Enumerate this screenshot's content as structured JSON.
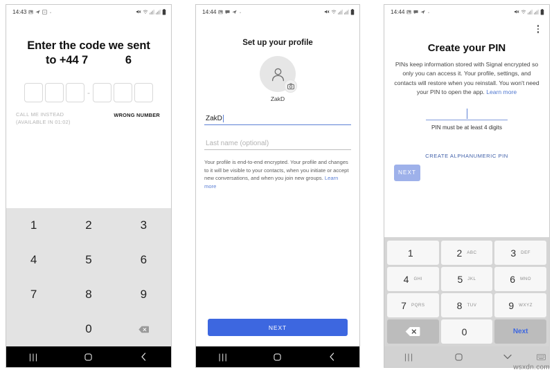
{
  "watermark": "wsxdn.com",
  "panel1": {
    "statusbar": {
      "time": "14:43",
      "left_icons": [
        "image-icon",
        "send-icon",
        "screenshot-icon",
        "dot-icon"
      ],
      "right_icons": [
        "mute-icon",
        "wifi-icon",
        "signal-icon",
        "signal2-icon",
        "battery-icon"
      ]
    },
    "heading_line1": "Enter the code we sent",
    "heading_line2": "to +44 7            6",
    "code_boxes": [
      "",
      "",
      "",
      "",
      "",
      ""
    ],
    "code_separator": "-",
    "call_me_label": "CALL ME INSTEAD",
    "call_me_timer": "(AVAILABLE IN 01:02)",
    "wrong_number_label": "WRONG NUMBER",
    "keypad": [
      "1",
      "2",
      "3",
      "4",
      "5",
      "6",
      "7",
      "8",
      "9",
      "",
      "0",
      "backspace-icon"
    ],
    "nav": {
      "recents": "|||",
      "home": "home-icon",
      "back": "back-icon"
    }
  },
  "panel2": {
    "statusbar": {
      "time": "14:44",
      "left_icons": [
        "image-icon",
        "message-icon",
        "send-icon",
        "dot-icon"
      ],
      "right_icons": [
        "mute-icon",
        "wifi-icon",
        "signal-icon",
        "signal2-icon",
        "battery-icon"
      ]
    },
    "title": "Set up your profile",
    "avatar_icon": "person-icon",
    "camera_badge_icon": "camera-icon",
    "avatar_name": "ZakD",
    "first_name_value": "ZakD",
    "last_name_placeholder": "Last name (optional)",
    "note_text": "Your profile is end-to-end encrypted. Your profile and changes to it will be visible to your contacts, when you initiate or accept new conversations, and when you join new groups. ",
    "note_link": "Learn more",
    "next_label": "NEXT",
    "nav": {
      "recents": "|||",
      "home": "home-icon",
      "back": "back-icon"
    }
  },
  "panel3": {
    "statusbar": {
      "time": "14:44",
      "left_icons": [
        "image-icon",
        "message-icon",
        "send-icon",
        "dot-icon"
      ],
      "right_icons": [
        "mute-icon",
        "wifi-icon",
        "signal-icon",
        "signal2-icon",
        "battery-icon"
      ]
    },
    "overflow_icon": "more-vertical-icon",
    "title": "Create your PIN",
    "body_text": "PINs keep information stored with Signal encrypted so only you can access it. Your profile, settings, and contacts will restore when you reinstall. You won't need your PIN to open the app. ",
    "body_link": "Learn more",
    "pin_value": "",
    "pin_hint": "PIN must be at least 4 digits",
    "alphanumeric_label": "CREATE ALPHANUMERIC PIN",
    "next_label": "NEXT",
    "keyboard": [
      {
        "num": "1",
        "sub": ""
      },
      {
        "num": "2",
        "sub": "ABC"
      },
      {
        "num": "3",
        "sub": "DEF"
      },
      {
        "num": "4",
        "sub": "GHI"
      },
      {
        "num": "5",
        "sub": "JKL"
      },
      {
        "num": "6",
        "sub": "MNO"
      },
      {
        "num": "7",
        "sub": "PQRS"
      },
      {
        "num": "8",
        "sub": "TUV"
      },
      {
        "num": "9",
        "sub": "WXYZ"
      },
      {
        "num": "backspace-icon",
        "sub": ""
      },
      {
        "num": "0",
        "sub": ""
      },
      {
        "num": "Next",
        "sub": ""
      }
    ],
    "nav": {
      "recents": "|||",
      "home": "home-icon",
      "down": "chevron-down-icon",
      "keyboard": "keyboard-icon"
    }
  },
  "colors": {
    "accent_blue": "#3d67e0",
    "accent_blue_disabled": "#9eb1ea",
    "link_blue": "#5b7fd4",
    "keypad_bg": "#e3e3e3",
    "keyboard_bg": "#d5d5d5",
    "navbar_dark": "#000000",
    "navbar_light": "#d2d2d2"
  }
}
